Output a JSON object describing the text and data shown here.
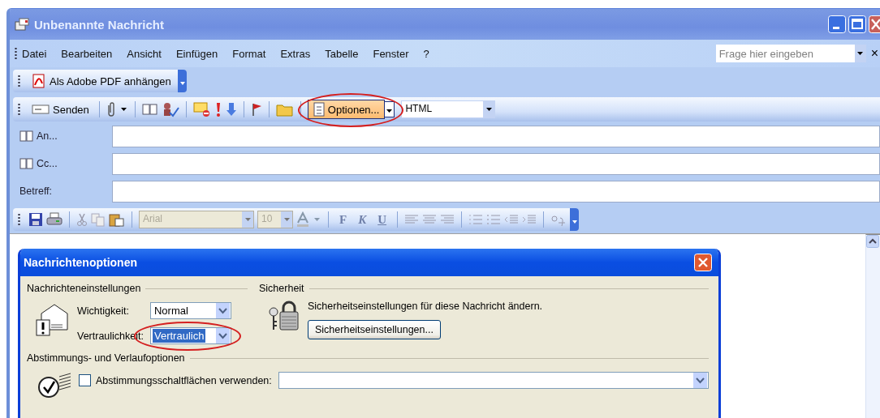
{
  "window": {
    "title": "Unbenannte Nachricht"
  },
  "menu": [
    "Datei",
    "Bearbeiten",
    "Ansicht",
    "Einfügen",
    "Format",
    "Extras",
    "Tabelle",
    "Fenster",
    "?"
  ],
  "help_box": {
    "placeholder": "Frage hier eingeben",
    "close": "×"
  },
  "adobe_toolbar": {
    "button": "Als Adobe PDF anhängen"
  },
  "standard_toolbar": {
    "send": "Senden",
    "options": {
      "label": "Optionen...",
      "circled": true
    },
    "format_select": "HTML"
  },
  "header_fields": [
    {
      "kind": "address",
      "label": "An..."
    },
    {
      "kind": "address",
      "label": "Cc..."
    },
    {
      "kind": "plain",
      "label": "Betreff:"
    }
  ],
  "format_toolbar": {
    "font": {
      "value": "Arial",
      "disabled": true
    },
    "size": {
      "value": "10",
      "disabled": true
    },
    "bold": "F",
    "italic": "K",
    "underline": "U"
  },
  "dialog": {
    "title": "Nachrichtenoptionen",
    "settings": {
      "heading": "Nachrichteneinstellungen",
      "rows": [
        {
          "label": "Wichtigkeit:",
          "value": "Normal",
          "highlighted": false,
          "circled": false
        },
        {
          "label": "Vertraulichkeit:",
          "value": "Vertraulich",
          "highlighted": true,
          "circled": true
        }
      ]
    },
    "security": {
      "heading": "Sicherheit",
      "text": "Sicherheitseinstellungen für diese Nachricht ändern.",
      "button": "Sicherheitseinstellungen..."
    },
    "voting": {
      "heading": "Abstimmungs- und Verlaufoptionen",
      "options": [
        {
          "label": "Abstimmungsschaltflächen verwenden:",
          "checked": false
        }
      ]
    }
  }
}
